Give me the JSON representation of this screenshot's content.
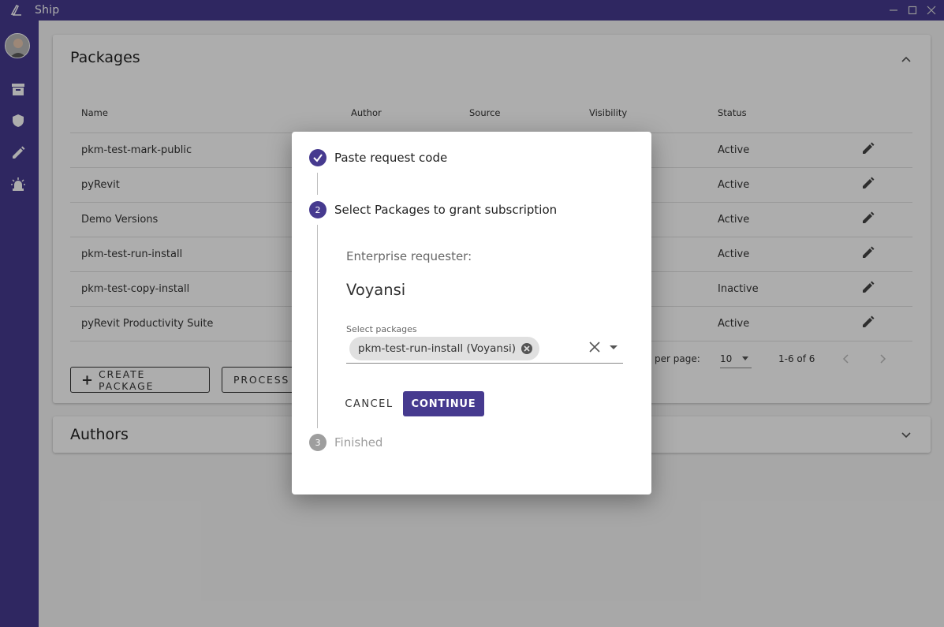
{
  "app": {
    "title": "Ship"
  },
  "packages": {
    "title": "Packages",
    "columns": [
      "Name",
      "Author",
      "Source",
      "Visibility",
      "Status"
    ],
    "rows": [
      {
        "name": "pkm-test-mark-public",
        "status": "Active"
      },
      {
        "name": "pyRevit",
        "status": "Active"
      },
      {
        "name": "Demo Versions",
        "status": "Active"
      },
      {
        "name": "pkm-test-run-install",
        "status": "Active"
      },
      {
        "name": "pkm-test-copy-install",
        "status": "Inactive"
      },
      {
        "name": "pyRevit Productivity Suite",
        "status": "Active"
      }
    ],
    "pager": {
      "rows_per_page_label": "per page:",
      "rows_per_page_value": "10",
      "range": "1-6 of 6"
    },
    "create_label": "CREATE PACKAGE",
    "process_label": "PROCESS S"
  },
  "authors": {
    "title": "Authors"
  },
  "dialog": {
    "steps": [
      {
        "number": "1",
        "label": "Paste request code",
        "state": "completed"
      },
      {
        "number": "2",
        "label": "Select Packages to grant subscription",
        "state": "active"
      },
      {
        "number": "3",
        "label": "Finished",
        "state": "pending"
      }
    ],
    "requester_label": "Enterprise requester:",
    "requester_value": "Voyansi",
    "select_label": "Select packages",
    "selected_chip": "pkm-test-run-install (Voyansi)",
    "cancel_label": "CANCEL",
    "continue_label": "CONTINUE"
  },
  "colors": {
    "accent": "#463a8f",
    "disabled_step": "#9e9e9e"
  },
  "icons": [
    "app-logo-icon",
    "archive-icon",
    "shield-icon",
    "pencil-icon",
    "alarm-icon",
    "edit-icon",
    "chevron-up-icon",
    "chevron-down-icon",
    "check-icon",
    "close-icon",
    "cancel-circle-icon",
    "dropdown-arrow-icon"
  ]
}
